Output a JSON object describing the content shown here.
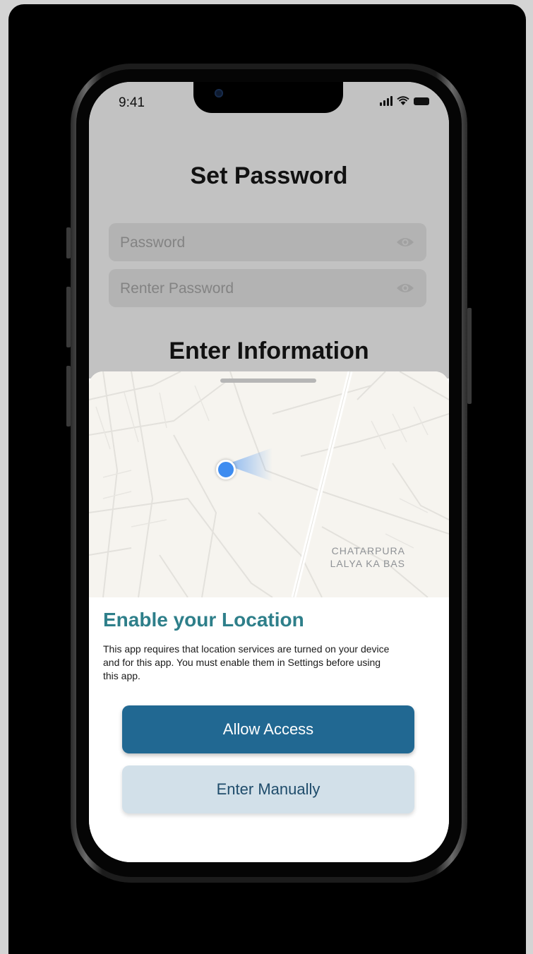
{
  "status_bar": {
    "time": "9:41",
    "icons": [
      "cellular-signal-icon",
      "wifi-icon",
      "battery-icon"
    ]
  },
  "background_screen": {
    "title": "Set Password",
    "password_placeholder": "Password",
    "reenter_placeholder": "Renter Password",
    "section_title": "Enter Information",
    "field_icon": "eye-icon"
  },
  "location_sheet": {
    "map_labels": [
      "CHATARPURA",
      "LALYA KA BAS"
    ],
    "heading": "Enable your Location",
    "body": "This app requires that location services are turned on your device and for this app. You must enable them in Settings before using this app.",
    "allow_button": "Allow Access",
    "manual_button": "Enter Manually"
  },
  "colors": {
    "heading": "#2e7f8a",
    "primary_button": "#216892",
    "secondary_button": "#d2e0e9",
    "location_dot": "#3e8cf0"
  }
}
